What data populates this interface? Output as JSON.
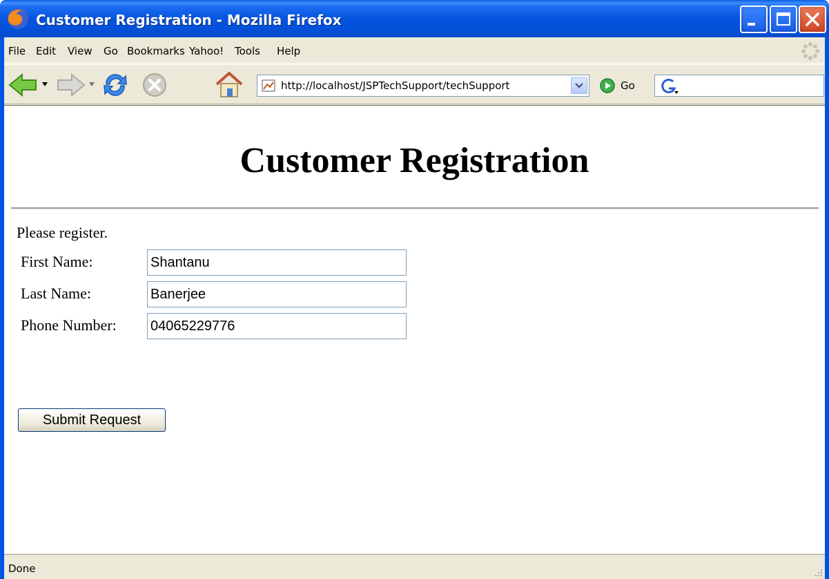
{
  "window": {
    "title": "Customer Registration - Mozilla Firefox"
  },
  "menubar": {
    "items": [
      "File",
      "Edit",
      "View",
      "Go",
      "Bookmarks",
      "Yahoo!",
      "Tools",
      "Help"
    ]
  },
  "toolbar": {
    "url": "http://localhost/JSPTechSupport/techSupport",
    "go_label": "Go",
    "search_value": ""
  },
  "page": {
    "title": "Customer Registration",
    "intro": "Please register.",
    "fields": [
      {
        "label": "First Name:",
        "value": "Shantanu"
      },
      {
        "label": "Last Name:",
        "value": "Banerjee"
      },
      {
        "label": "Phone Number:",
        "value": "04065229776"
      }
    ],
    "submit_label": "Submit Request"
  },
  "statusbar": {
    "text": "Done"
  },
  "colors": {
    "titlebar_blue": "#0054e3",
    "chrome_beige": "#ece9d8",
    "input_border": "#7f9db9",
    "close_red": "#d24623"
  }
}
